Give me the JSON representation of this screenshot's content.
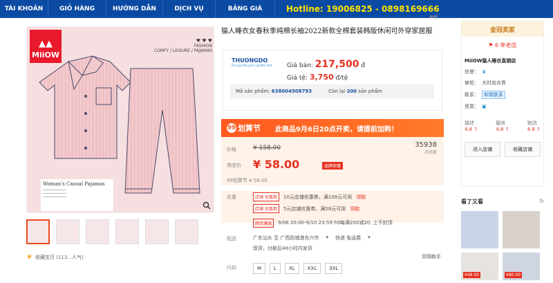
{
  "nav": {
    "items": [
      "TÀI KHOẢN",
      "GIỎ HÀNG",
      "HƯỚNG DẪN",
      "DỊCH VỤ",
      "BẢNG GIÁ"
    ],
    "hotline": "Hotline: 19006825 - 0898169666"
  },
  "image": {
    "brand": "MiiOW",
    "fashion_line1": "FASHION",
    "fashion_line2": "COMFY / LEISURE / PAJAMAS",
    "caption": "Woman's Casual Pajamas"
  },
  "tag_top": "举报",
  "product": {
    "title": "猫人睡衣女春秋季纯棉长袖2022新款全棉套装韩版休闲可外穿家居服",
    "logo_name": "THUONGDO",
    "logo_sub": "Occupy the price quality Viet",
    "sell_label": "Giá bán:",
    "sell_price": "217,500",
    "currency": "đ",
    "rate_label": "Giá tệ:",
    "rate_price": "3,750",
    "rate_unit": "đ/tệ",
    "code_label": "Mã sản phẩm:",
    "code_value": "638004508793",
    "stock_prefix": "Còn lại",
    "stock_value": "200",
    "stock_suffix": "sản phẩm"
  },
  "promo": {
    "logo": "划算节",
    "message": "此商品9月6日20点开卖，请提前加购！"
  },
  "pricing": {
    "price_label": "价格",
    "original": "¥ 158.00",
    "taobao_label": "淘宝价",
    "sale": "¥ 58.00",
    "badge": "品牌钜惠",
    "sold_count": "35938",
    "sold_unit": "月销量",
    "festival_label": "99划算节",
    "festival_price": "¥ 58.00"
  },
  "offers": {
    "label": "优惠",
    "coupon_tag": "店铺 优惠券",
    "coupon1": "10元店铺优惠券，满108元可用",
    "coupon2": "5元店铺优惠券，满58元可用",
    "claim": "领取",
    "cross_tag": "跨店满减",
    "cross_text": "9/06 20:00-9/10 23:59:59每满200减20, 上不封顶"
  },
  "shipping": {
    "label": "配送",
    "route": "广东汕头 至 广西防城港东兴市",
    "express": "快递 免运费",
    "note": "现货，付款后48小时内发货"
  },
  "size": {
    "label": "尺码",
    "options": [
      "M",
      "L",
      "XL",
      "XXL",
      "3XL"
    ]
  },
  "assistant": "另购助手",
  "favorite": "收藏宝贝 (113...人气)",
  "shop": {
    "header": "金冠卖家",
    "years": "6 年老店",
    "name": "MiiOW猫人睡衣直销店",
    "credit_label": "信誉：",
    "keeper_label": "掌柜：",
    "keeper_value": "大时尚衣界",
    "contact_label": "联系：",
    "contact_value": "和我联系",
    "qual_label": "资质：",
    "ratings": [
      {
        "name": "描述",
        "score": "4.8 ↑"
      },
      {
        "name": "服务",
        "score": "4.8 ↑"
      },
      {
        "name": "物流",
        "score": "4.8 ↑"
      }
    ],
    "enter_btn": "进入店铺",
    "collect_btn": "收藏店铺"
  },
  "see_also": {
    "title": "看了又看",
    "prices": [
      "¥48.00",
      "¥80.00"
    ]
  },
  "colors": {
    "nav": "#0b4aa2",
    "hotline": "#ffe400",
    "accent": "#e53020",
    "promo": "#ff5a1f"
  }
}
